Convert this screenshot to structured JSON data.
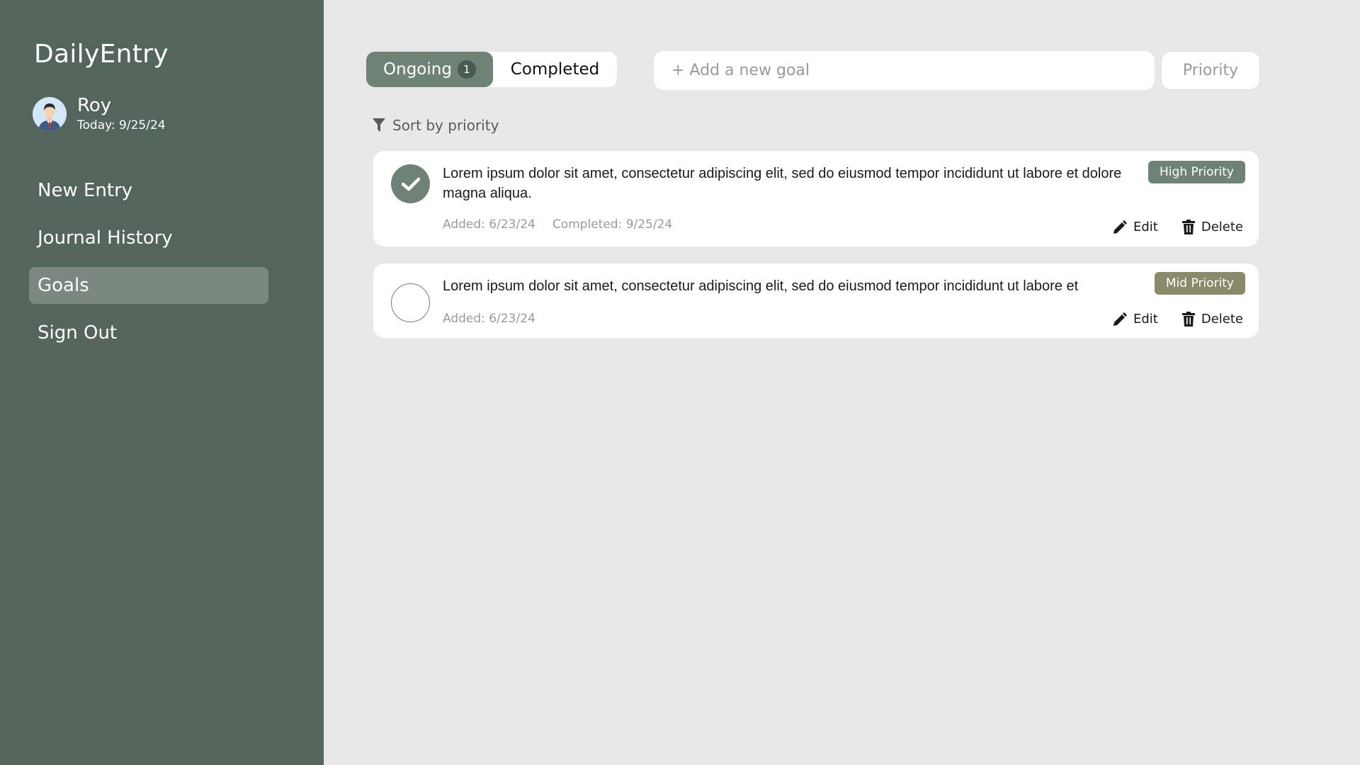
{
  "app": {
    "title": "DailyEntry"
  },
  "user": {
    "name": "Roy",
    "today_label": "Today: 9/25/24"
  },
  "nav": {
    "items": [
      {
        "label": "New Entry"
      },
      {
        "label": "Journal History"
      },
      {
        "label": "Goals",
        "active": true
      },
      {
        "label": "Sign Out"
      }
    ]
  },
  "tabs": {
    "ongoing_label": "Ongoing",
    "ongoing_count": "1",
    "completed_label": "Completed"
  },
  "add_goal": {
    "placeholder": "+ Add a new goal",
    "value": ""
  },
  "priority_select": {
    "label": "Priority"
  },
  "sort": {
    "label": "Sort by priority"
  },
  "goals": [
    {
      "text": "Lorem ipsum dolor sit amet, consectetur adipiscing elit, sed do eiusmod tempor incididunt ut labore et dolore magna aliqua.",
      "added": "Added: 6/23/24",
      "completed": "Completed: 9/25/24",
      "priority": "High Priority",
      "done": true
    },
    {
      "text": "Lorem ipsum dolor sit amet, consectetur adipiscing elit, sed do eiusmod tempor incididunt ut labore et",
      "added": "Added: 6/23/24",
      "priority": "Mid Priority",
      "done": false
    }
  ],
  "actions": {
    "edit_label": "Edit",
    "delete_label": "Delete"
  },
  "colors": {
    "sidebar_bg": "#54655c",
    "accent": "#6e8376",
    "mid_priority": "#8a8a6b",
    "page_bg": "#e8e8e8"
  },
  "icons": {
    "avatar": "user-avatar-icon",
    "sort": "filter-icon",
    "check": "checkmark-icon",
    "edit": "pencil-icon",
    "delete": "trash-icon"
  }
}
